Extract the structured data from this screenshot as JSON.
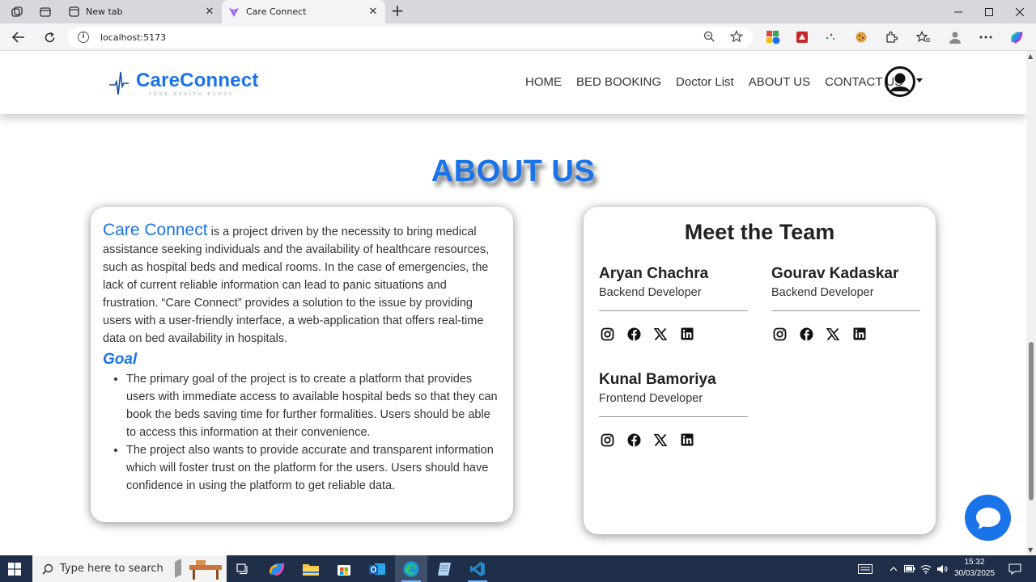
{
  "browser": {
    "tabs": [
      {
        "title": "New tab"
      },
      {
        "title": "Care Connect"
      }
    ],
    "address": "localhost:5173"
  },
  "site": {
    "logo_text": "CareConnect",
    "logo_tagline": "YOUR HEALTH BUDDY",
    "nav": [
      "HOME",
      "BED BOOKING",
      "Doctor List",
      "ABOUT US",
      "CONTACT US"
    ]
  },
  "about": {
    "title": "ABOUT US",
    "brand": "Care Connect",
    "description": " is a project driven by the necessity to bring medical assistance seeking individuals and the availability of healthcare resources, such as hospital beds and medical rooms. In the case of emergencies, the lack of current reliable information can lead to panic situations and frustration. “Care Connect” provides a solution to the issue by providing users with a user-friendly interface, a web-application that offers real-time data on bed availability in hospitals.",
    "goal_heading": "Goal",
    "goals": [
      "The primary goal of the project is to create a platform that provides users with immediate access to available hospital beds so that they can book the beds saving time for further formalities. Users should be able to access this information at their convenience.",
      "The project also wants to provide accurate and transparent information which will foster trust on the platform for the users. Users should have confidence in using the platform to get reliable data."
    ]
  },
  "team": {
    "title": "Meet the Team",
    "members": [
      {
        "name": "Aryan Chachra",
        "role": "Backend Developer"
      },
      {
        "name": "Gourav Kadaskar",
        "role": "Backend Developer"
      },
      {
        "name": "Kunal Bamoriya",
        "role": "Frontend Developer"
      }
    ],
    "social_icons": [
      "instagram-icon",
      "facebook-icon",
      "x-icon",
      "linkedin-icon"
    ]
  },
  "taskbar": {
    "search_placeholder": "Type here to search",
    "time": "15:32",
    "date": "30/03/2025"
  },
  "colors": {
    "brand_blue": "#1a73e8",
    "taskbar": "#1f2f4a"
  }
}
